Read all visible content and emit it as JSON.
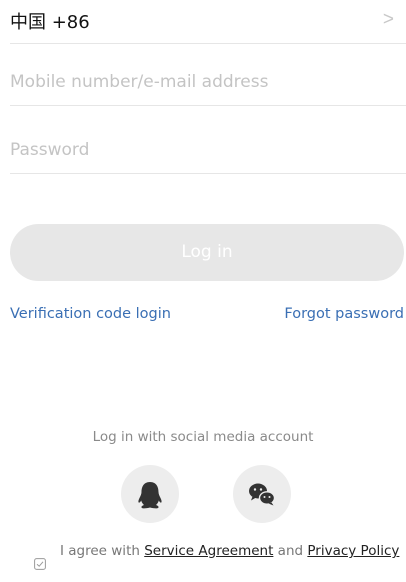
{
  "region": {
    "label": "中国 +86",
    "chevron": ">"
  },
  "mobile": {
    "value": "",
    "placeholder": "Mobile number/e-mail address"
  },
  "password": {
    "value": "",
    "placeholder": "Password"
  },
  "login_button": {
    "label": "Log in",
    "enabled": false
  },
  "links": {
    "verification_code": "Verification code login",
    "forgot_password": "Forgot password"
  },
  "social": {
    "caption": "Log in with social media account",
    "providers": [
      {
        "name": "QQ",
        "icon": "qq-penguin-icon"
      },
      {
        "name": "WeChat",
        "icon": "wechat-icon"
      }
    ]
  },
  "agreement": {
    "checked": false,
    "prefix": "I agree with ",
    "service_link": "Service Agreement",
    "conjunction": " and ",
    "privacy_link": "Privacy Policy"
  },
  "colors": {
    "link": "#3a6fb4",
    "button_disabled": "#e7e7e7",
    "divider": "#e6e6e6",
    "placeholder": "#c4c4c4",
    "icon": "#333333"
  }
}
